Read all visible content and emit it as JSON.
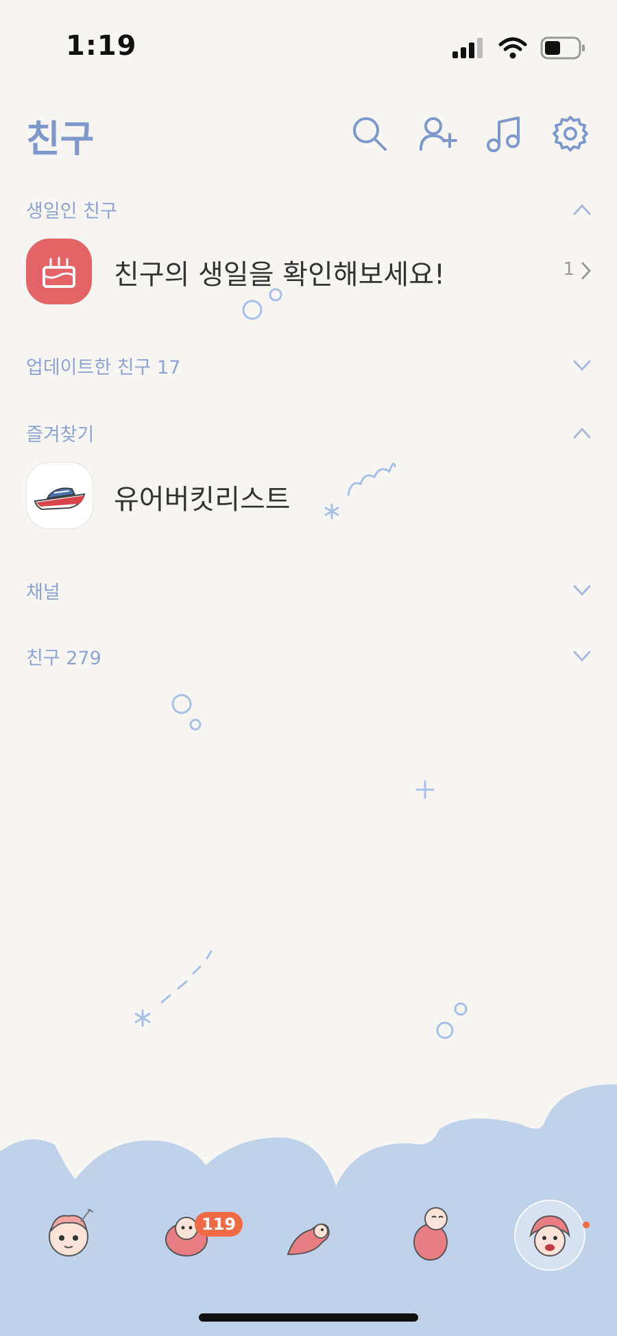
{
  "status_bar": {
    "time": "1:19"
  },
  "header": {
    "title": "친구"
  },
  "sections": {
    "birthday": {
      "label": "생일인 친구",
      "row_text": "친구의 생일을 확인해보세요!",
      "count": "1"
    },
    "updated": {
      "label": "업데이트한 친구 17"
    },
    "favorites": {
      "label": "즐겨찾기",
      "item_name": "유어버킷리스트"
    },
    "channels": {
      "label": "채널"
    },
    "friends": {
      "label": "친구 279"
    }
  },
  "tab_bar": {
    "chats_badge": "119",
    "accent_color": "#f06a45"
  },
  "colors": {
    "primary": "#7f98cc",
    "label": "#8ea3d0",
    "background": "#f7f5f2",
    "wave": "#c0d2ea"
  }
}
